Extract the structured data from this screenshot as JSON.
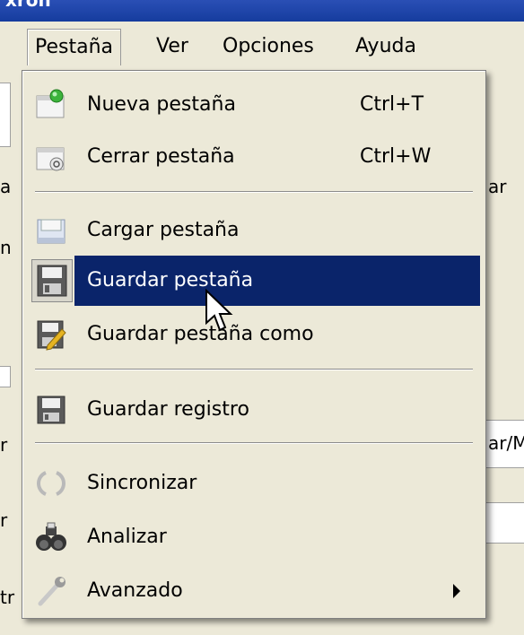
{
  "window": {
    "title_fragment": "xron"
  },
  "menubar": {
    "items": [
      {
        "label": "Pestaña",
        "open": true
      },
      {
        "label": "Ver"
      },
      {
        "label": "Opciones"
      },
      {
        "label": "Ayuda"
      }
    ]
  },
  "background_fragments": {
    "left": [
      "a",
      "n",
      "r",
      "r",
      "tr"
    ],
    "right": [
      "ar",
      "ar/M"
    ]
  },
  "menu": {
    "items": [
      {
        "label": "Nueva pestaña",
        "shortcut": "Ctrl+T",
        "icon": "new-tab-icon"
      },
      {
        "label": "Cerrar pestaña",
        "shortcut": "Ctrl+W",
        "icon": "close-tab-icon"
      },
      {
        "label": "Cargar pestaña",
        "icon": "load-tab-icon"
      },
      {
        "label": "Guardar pestaña",
        "icon": "save-icon",
        "highlighted": true
      },
      {
        "label": "Guardar pestaña como",
        "icon": "save-as-icon"
      },
      {
        "label": "Guardar registro",
        "icon": "save-log-icon"
      },
      {
        "label": "Sincronizar",
        "icon": "sync-icon",
        "disabled": true
      },
      {
        "label": "Analizar",
        "icon": "binoculars-icon"
      },
      {
        "label": "Avanzado",
        "icon": "wrench-icon",
        "submenu": true
      }
    ]
  },
  "colors": {
    "highlight": "#0a246a",
    "menu_bg": "#ece9d8",
    "title_bar": "#153c9e"
  }
}
